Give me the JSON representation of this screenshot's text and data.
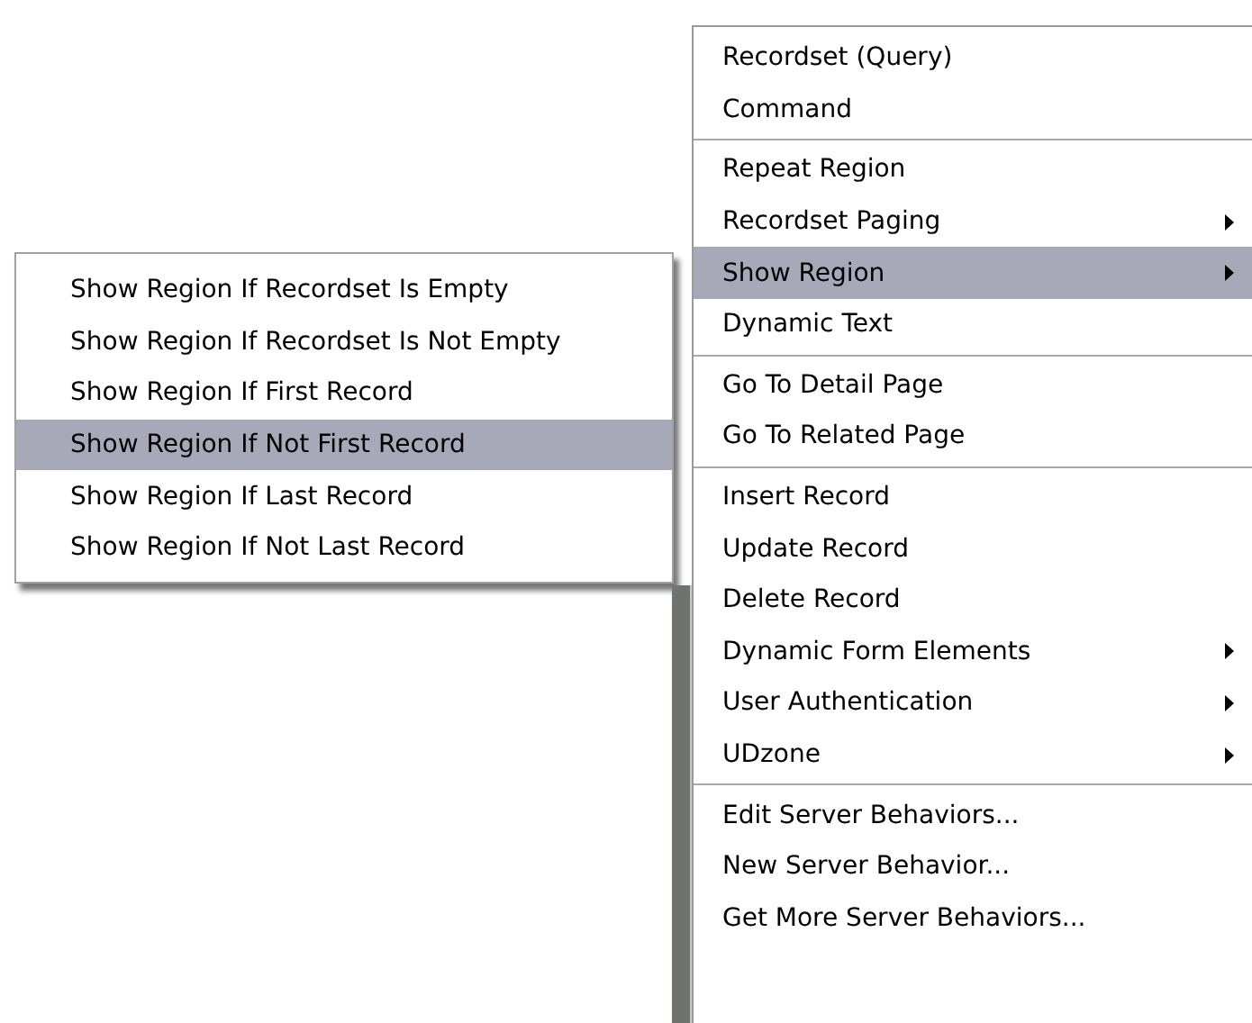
{
  "context_menu": {
    "groups": [
      [
        {
          "label": "Recordset (Query)",
          "has_submenu": false,
          "selected": false
        },
        {
          "label": "Command",
          "has_submenu": false,
          "selected": false
        }
      ],
      [
        {
          "label": "Repeat Region",
          "has_submenu": false,
          "selected": false
        },
        {
          "label": "Recordset Paging",
          "has_submenu": true,
          "selected": false
        },
        {
          "label": "Show Region",
          "has_submenu": true,
          "selected": true
        },
        {
          "label": "Dynamic Text",
          "has_submenu": false,
          "selected": false
        }
      ],
      [
        {
          "label": "Go To Detail Page",
          "has_submenu": false,
          "selected": false
        },
        {
          "label": "Go To Related Page",
          "has_submenu": false,
          "selected": false
        }
      ],
      [
        {
          "label": "Insert Record",
          "has_submenu": false,
          "selected": false
        },
        {
          "label": "Update Record",
          "has_submenu": false,
          "selected": false
        },
        {
          "label": "Delete Record",
          "has_submenu": false,
          "selected": false
        },
        {
          "label": "Dynamic Form Elements",
          "has_submenu": true,
          "selected": false
        },
        {
          "label": "User Authentication",
          "has_submenu": true,
          "selected": false
        },
        {
          "label": "UDzone",
          "has_submenu": true,
          "selected": false
        }
      ],
      [
        {
          "label": "Edit Server Behaviors...",
          "has_submenu": false,
          "selected": false
        },
        {
          "label": "New Server Behavior...",
          "has_submenu": false,
          "selected": false
        },
        {
          "label": "Get More Server Behaviors...",
          "has_submenu": false,
          "selected": false
        }
      ]
    ]
  },
  "submenu": {
    "items": [
      {
        "label": "Show Region If Recordset Is Empty",
        "selected": false
      },
      {
        "label": "Show Region If Recordset Is Not Empty",
        "selected": false
      },
      {
        "label": "Show Region If First Record",
        "selected": false
      },
      {
        "label": "Show Region If Not First Record",
        "selected": true
      },
      {
        "label": "Show Region If Last Record",
        "selected": false
      },
      {
        "label": "Show Region If Not Last Record",
        "selected": false
      }
    ]
  }
}
